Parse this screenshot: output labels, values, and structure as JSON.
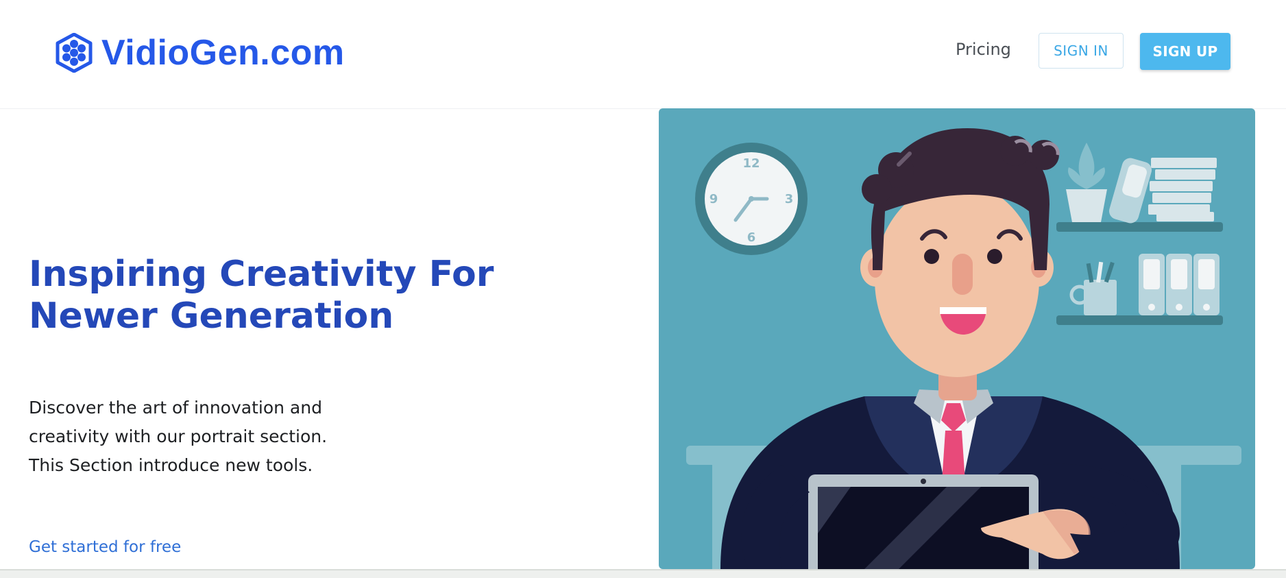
{
  "header": {
    "logo_text": "VidioGen.com",
    "logo_icon": "hexagon-flower-icon",
    "nav": {
      "pricing": "Pricing"
    },
    "buttons": {
      "sign_in": "SIGN IN",
      "sign_up": "SIGN UP"
    }
  },
  "hero": {
    "title": "Inspiring Creativity For Newer Generation",
    "description": "Discover the art of innovation and creativity with our portrait section. This Section introduce new tools.",
    "cta": "Get started for free"
  },
  "illustration": {
    "clock_numbers": [
      "12",
      "3",
      "6",
      "9"
    ]
  },
  "colors": {
    "brand_blue": "#2558e8",
    "title_blue": "#2448b8",
    "signup_bg": "#4db8ee",
    "link_blue": "#2f6fd6",
    "illustration_bg": "#5aa8bb"
  }
}
